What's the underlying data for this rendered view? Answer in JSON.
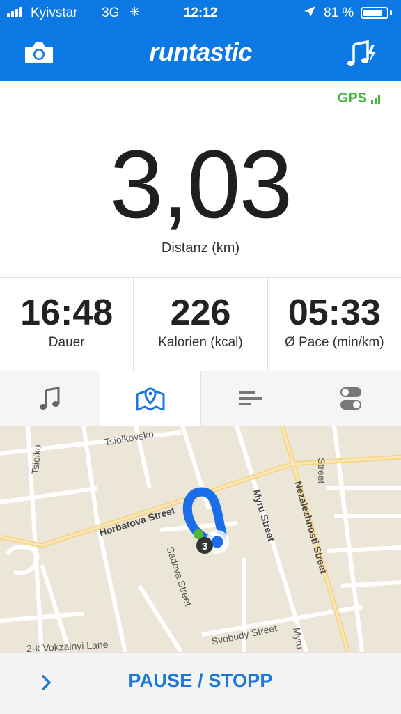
{
  "status_bar": {
    "carrier": "Kyivstar",
    "network": "3G",
    "time": "12:12",
    "battery": "81 %",
    "battery_level": 0.81
  },
  "app_bar": {
    "title": "runtastic",
    "left_icon": "camera-icon",
    "right_icon": "music-boost-icon",
    "color": "#0b78e3"
  },
  "gps": {
    "label": "GPS",
    "color": "#3fb63a"
  },
  "distance": {
    "value": "3,03",
    "label": "Distanz (km)"
  },
  "stats": [
    {
      "value": "16:48",
      "label": "Dauer"
    },
    {
      "value": "226",
      "label": "Kalorien (kcal)"
    },
    {
      "value": "05:33",
      "label": "Ø Pace (min/km)"
    }
  ],
  "tabs": [
    {
      "icon": "music-note-icon",
      "active": false
    },
    {
      "icon": "map-pin-icon",
      "active": true
    },
    {
      "icon": "bars-icon",
      "active": false
    },
    {
      "icon": "toggles-icon",
      "active": false
    }
  ],
  "map": {
    "streets": {
      "tsiolkovskoho_1": "Tsiolko",
      "tsiolkovskoho_2": "Tsiolkovsko",
      "street_top_right": "Street",
      "horbatova": "Horbatova Street",
      "myru": "Myru Street",
      "nezalezhnosti": "Nezalezhnosti Street",
      "sadova": "Sadova Street",
      "svobody": "Svobody Street",
      "myru_2": "Myru",
      "bottom_left": "2-k Vokzalnyi Lane"
    },
    "route_color": "#1a6fe8",
    "km_marker": "3"
  },
  "controls": {
    "pause_label": "PAUSE / STOPP",
    "accent": "#1a78dd"
  }
}
